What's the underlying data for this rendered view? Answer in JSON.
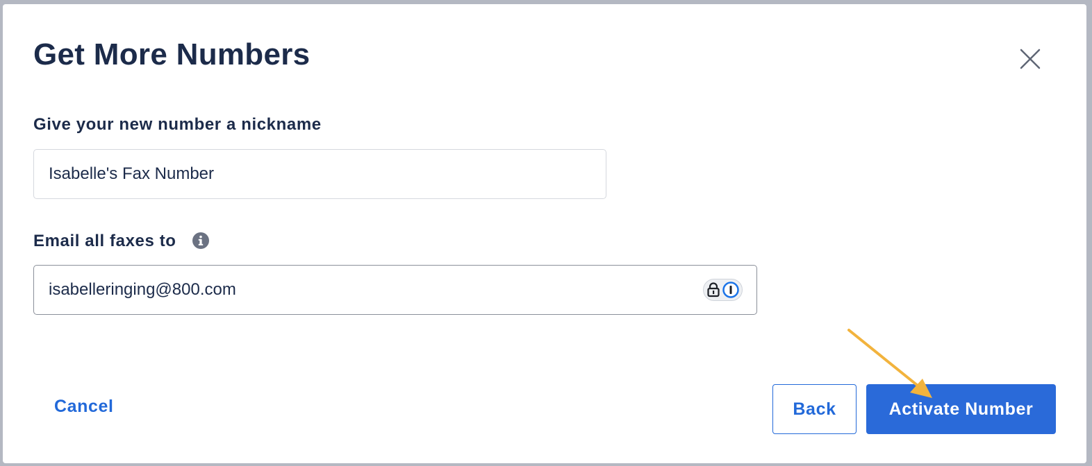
{
  "modal": {
    "title": "Get More Numbers",
    "close_icon": "close-icon"
  },
  "form": {
    "nickname": {
      "label": "Give your new number a nickname",
      "value": "Isabelle's Fax Number"
    },
    "email": {
      "label": "Email all faxes to",
      "info_icon": "info-icon",
      "value": "isabelleringing@800.com",
      "password_manager_icon": "password-manager-icon"
    }
  },
  "actions": {
    "cancel_label": "Cancel",
    "back_label": "Back",
    "activate_label": "Activate Number"
  },
  "annotation": {
    "arrow_color": "#f2b33d"
  },
  "colors": {
    "primary": "#2269d9",
    "text": "#1c2b4a",
    "backdrop": "#b4b8c2"
  }
}
